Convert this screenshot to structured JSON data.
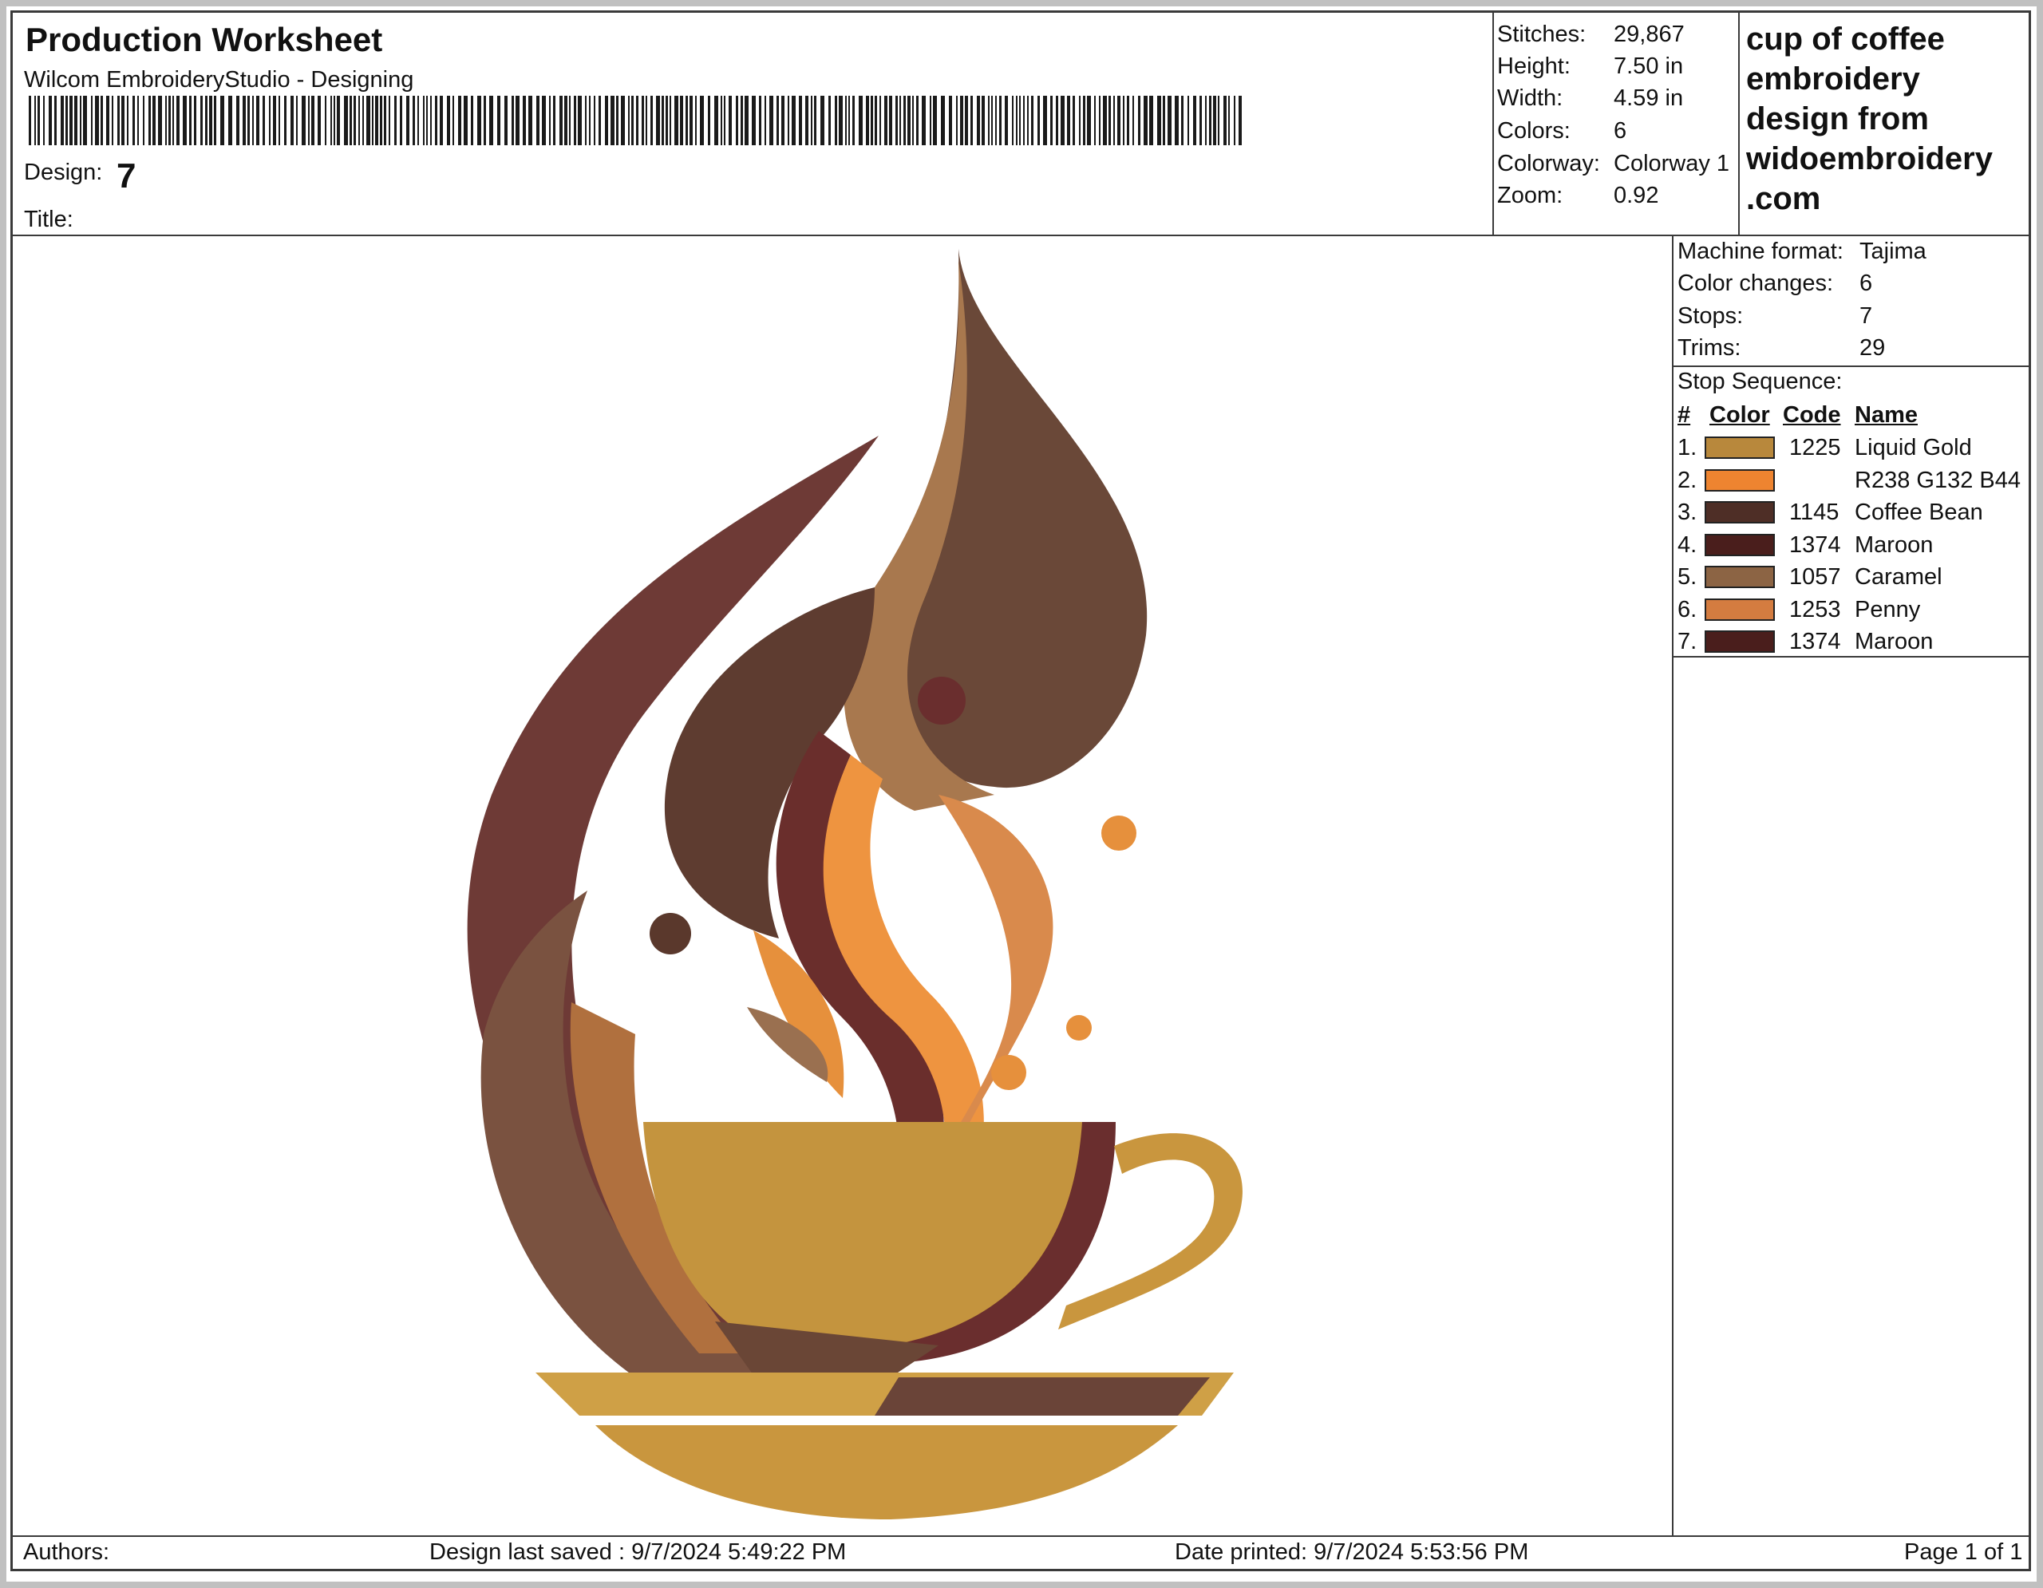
{
  "header": {
    "title": "Production Worksheet",
    "subtitle": "Wilcom EmbroideryStudio - Designing",
    "design_label": "Design:",
    "design_value": "7",
    "title_label": "Title:",
    "title_value": ""
  },
  "stats": [
    {
      "label": "Stitches:",
      "value": "29,867"
    },
    {
      "label": "Height:",
      "value": "7.50 in"
    },
    {
      "label": "Width:",
      "value": "4.59 in"
    },
    {
      "label": "Colors:",
      "value": "6"
    },
    {
      "label": "Colorway:",
      "value": "Colorway 1"
    },
    {
      "label": "Zoom:",
      "value": "0.92"
    }
  ],
  "description": "cup of coffee embroidery design from widoembroidery .com",
  "machine": [
    {
      "label": "Machine format:",
      "value": "Tajima"
    },
    {
      "label": "Color changes:",
      "value": "6"
    },
    {
      "label": "Stops:",
      "value": "7"
    },
    {
      "label": "Trims:",
      "value": "29"
    }
  ],
  "stop_sequence": {
    "label": "Stop Sequence:",
    "headers": {
      "num": "#",
      "color": "Color",
      "code": "Code",
      "name": "Name"
    },
    "rows": [
      {
        "num": "1.",
        "color": "#b8883c",
        "code": "1225",
        "name": "Liquid Gold"
      },
      {
        "num": "2.",
        "color": "#ee8430",
        "code": "",
        "name": "R238 G132 B44"
      },
      {
        "num": "3.",
        "color": "#4e2e26",
        "code": "1145",
        "name": "Coffee Bean"
      },
      {
        "num": "4.",
        "color": "#4a1e1c",
        "code": "1374",
        "name": "Maroon"
      },
      {
        "num": "5.",
        "color": "#8c6444",
        "code": "1057",
        "name": "Caramel"
      },
      {
        "num": "6.",
        "color": "#d47c40",
        "code": "1253",
        "name": "Penny"
      },
      {
        "num": "7.",
        "color": "#4a1e1c",
        "code": "1374",
        "name": "Maroon"
      }
    ]
  },
  "footer": {
    "authors": "Authors:",
    "saved": "Design last saved : 9/7/2024 5:49:22 PM",
    "printed": "Date printed: 9/7/2024 5:53:56 PM",
    "page": "Page 1 of 1"
  }
}
